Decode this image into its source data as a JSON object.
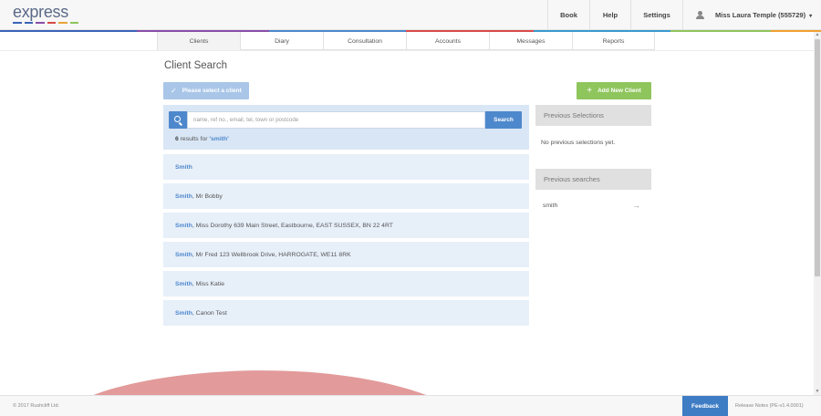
{
  "header": {
    "logo_text": "express",
    "logo_colors": [
      "#3a63b8",
      "#3a63b8",
      "#8a4ea8",
      "#d94a4a",
      "#e8a33a",
      "#8fc55d"
    ],
    "nav": {
      "book": "Book",
      "help": "Help",
      "settings": "Settings",
      "user": "Miss Laura Temple (555729)",
      "user_caret": "▾"
    }
  },
  "colorstrip": [
    "#3a63b8",
    "#8a4ea8",
    "#4e88cc",
    "#d94a4a",
    "#3a9ad0",
    "#8fc55d",
    "#f0a030"
  ],
  "tabs": [
    {
      "label": "Clients",
      "active": true
    },
    {
      "label": "Diary"
    },
    {
      "label": "Consultation"
    },
    {
      "label": "Accounts"
    },
    {
      "label": "Messages"
    },
    {
      "label": "Reports"
    }
  ],
  "main": {
    "title": "Client Search",
    "select_button": "Please select a client",
    "add_button": "Add New Client",
    "search": {
      "placeholder": "name, ref no., email, tel, town or postcode",
      "value": "",
      "button": "Search",
      "count": "6",
      "count_text": " results for ",
      "term": "'smith'"
    },
    "results": [
      {
        "name": "Smith",
        "detail": ""
      },
      {
        "name": "Smith",
        "detail": ", Mr Bobby"
      },
      {
        "name": "Smith",
        "detail": ", Miss Dorothy 639 Main Street, Eastbourne, EAST SUSSEX, BN 22 4RT"
      },
      {
        "name": "Smith",
        "detail": ", Mr Fred 123 Wellbrook Drive, HARROGATE, WE11 8RK"
      },
      {
        "name": "Smith",
        "detail": ", Miss Katie"
      },
      {
        "name": "Smith",
        "detail": ", Canon Test"
      }
    ]
  },
  "sidebar": {
    "previous_selections_title": "Previous Selections",
    "previous_selections_empty": "No previous selections yet.",
    "previous_searches_title": "Previous searches",
    "previous_searches": [
      "smith"
    ],
    "arrow": "→"
  },
  "footer": {
    "copyright": "© 2017 Rushcliff Ltd.",
    "feedback": "Feedback",
    "release": "Release Notes (PE-v1.4.0001)"
  },
  "colors": {
    "accent_blue": "#4e88cc",
    "accent_green": "#8fc55d",
    "result_bg": "#e7eff9",
    "wave": "#e29a9a"
  }
}
